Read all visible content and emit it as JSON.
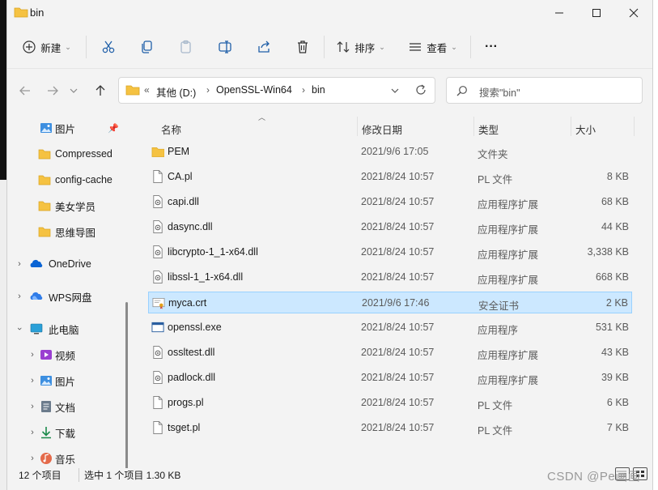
{
  "window": {
    "title": "bin"
  },
  "toolbar": {
    "new_label": "新建",
    "sort_label": "排序",
    "view_label": "查看",
    "more_label": "···"
  },
  "nav": {
    "breadcrumb_prefix": "«",
    "breadcrumbs": [
      "其他 (D:)",
      "OpenSSL-Win64",
      "bin"
    ],
    "search_placeholder": "搜索\"bin\""
  },
  "sidebar": {
    "items": [
      {
        "label": "图片",
        "icon": "pictures-icon",
        "pinned": true
      },
      {
        "label": "Compressed",
        "icon": "folder-icon"
      },
      {
        "label": "config-cache",
        "icon": "folder-icon"
      },
      {
        "label": "美女学员",
        "icon": "folder-icon"
      },
      {
        "label": "思维导图",
        "icon": "folder-icon"
      },
      {
        "label": "OneDrive",
        "icon": "onedrive-icon"
      },
      {
        "label": "WPS网盘",
        "icon": "wps-cloud-icon"
      },
      {
        "label": "此电脑",
        "icon": "computer-icon"
      },
      {
        "label": "视频",
        "icon": "videos-icon"
      },
      {
        "label": "图片",
        "icon": "pictures-icon"
      },
      {
        "label": "文档",
        "icon": "documents-icon"
      },
      {
        "label": "下载",
        "icon": "downloads-icon"
      },
      {
        "label": "音乐",
        "icon": "music-icon"
      }
    ]
  },
  "columns": {
    "name": "名称",
    "date": "修改日期",
    "type": "类型",
    "size": "大小"
  },
  "files": [
    {
      "name": "PEM",
      "date": "2021/9/6 17:05",
      "type": "文件夹",
      "size": "",
      "icon": "folder-icon"
    },
    {
      "name": "CA.pl",
      "date": "2021/8/24 10:57",
      "type": "PL 文件",
      "size": "8 KB",
      "icon": "file-icon"
    },
    {
      "name": "capi.dll",
      "date": "2021/8/24 10:57",
      "type": "应用程序扩展",
      "size": "68 KB",
      "icon": "dll-icon"
    },
    {
      "name": "dasync.dll",
      "date": "2021/8/24 10:57",
      "type": "应用程序扩展",
      "size": "44 KB",
      "icon": "dll-icon"
    },
    {
      "name": "libcrypto-1_1-x64.dll",
      "date": "2021/8/24 10:57",
      "type": "应用程序扩展",
      "size": "3,338 KB",
      "icon": "dll-icon"
    },
    {
      "name": "libssl-1_1-x64.dll",
      "date": "2021/8/24 10:57",
      "type": "应用程序扩展",
      "size": "668 KB",
      "icon": "dll-icon"
    },
    {
      "name": "myca.crt",
      "date": "2021/9/6 17:46",
      "type": "安全证书",
      "size": "2 KB",
      "icon": "certificate-icon",
      "selected": true
    },
    {
      "name": "openssl.exe",
      "date": "2021/8/24 10:57",
      "type": "应用程序",
      "size": "531 KB",
      "icon": "exe-icon"
    },
    {
      "name": "ossltest.dll",
      "date": "2021/8/24 10:57",
      "type": "应用程序扩展",
      "size": "43 KB",
      "icon": "dll-icon"
    },
    {
      "name": "padlock.dll",
      "date": "2021/8/24 10:57",
      "type": "应用程序扩展",
      "size": "39 KB",
      "icon": "dll-icon"
    },
    {
      "name": "progs.pl",
      "date": "2021/8/24 10:57",
      "type": "PL 文件",
      "size": "6 KB",
      "icon": "file-icon"
    },
    {
      "name": "tsget.pl",
      "date": "2021/8/24 10:57",
      "type": "PL 文件",
      "size": "7 KB",
      "icon": "file-icon"
    }
  ],
  "status": {
    "count": "12 个项目",
    "selection": "选中 1 个项目  1.30 KB"
  },
  "watermark": "CSDN @Pe画画",
  "colors": {
    "selection_bg": "#cce8ff",
    "selection_border": "#99d1ff",
    "folder": "#f5c242",
    "accent": "#0067c0"
  }
}
